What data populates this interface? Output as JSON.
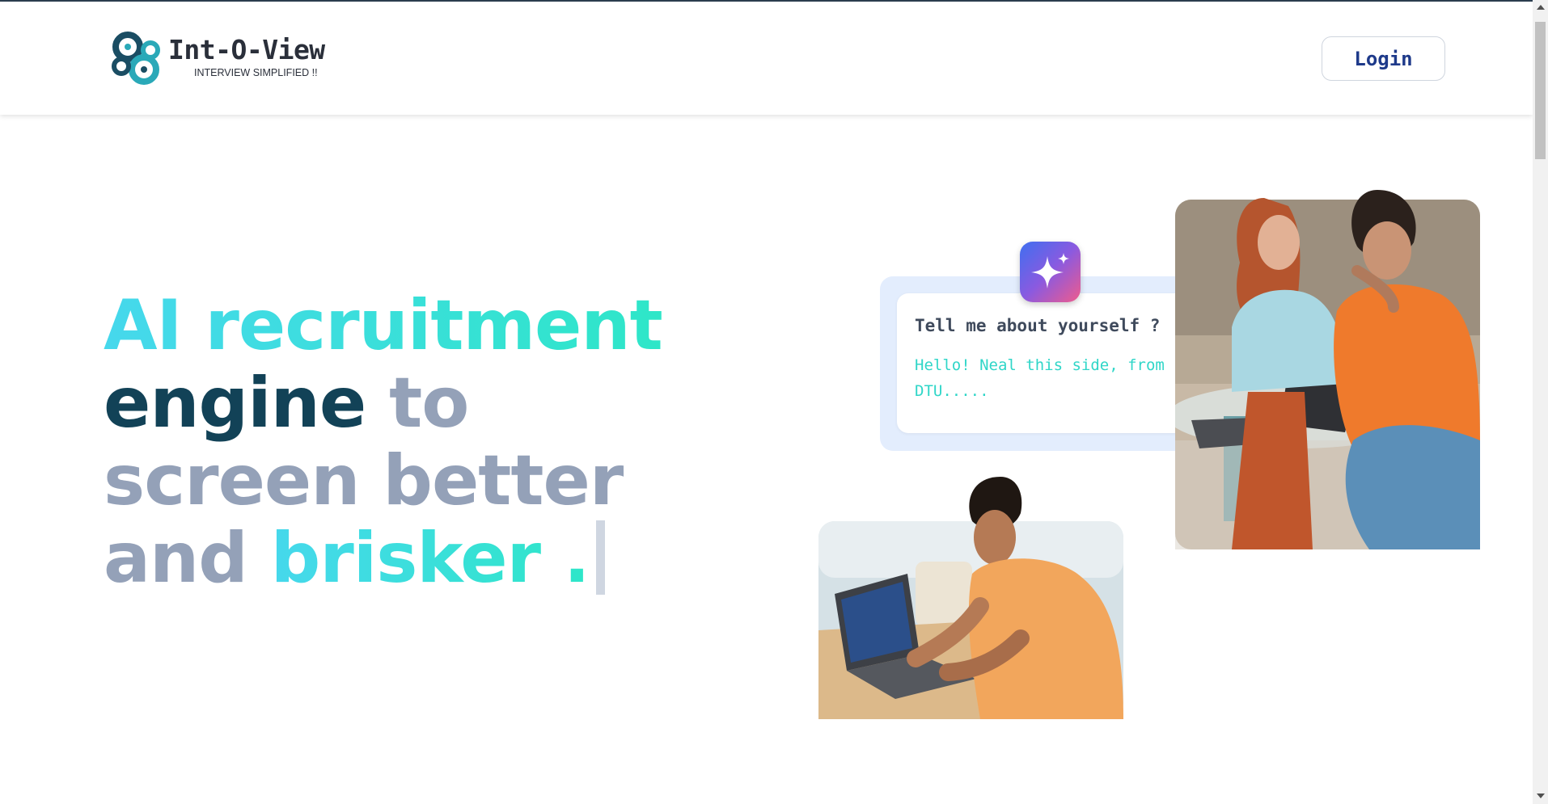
{
  "brand": {
    "name": "Int-O-View",
    "tagline": "INTERVIEW SIMPLIFIED !!"
  },
  "header": {
    "login_label": "Login"
  },
  "hero": {
    "line1": "AI recruitment",
    "line2_dark": "engine",
    "line2_muted": "to",
    "line3": "screen better",
    "line4_muted": "and",
    "line4_grad": "brisker ."
  },
  "chat": {
    "question": "Tell me about yourself ?",
    "answer": "Hello! Neal this side, from DTU....."
  },
  "icons": {
    "ai": "sparkle-icon",
    "logo": "intertwined-loops-logo"
  },
  "colors": {
    "accent_gradient_start": "#46d8ec",
    "accent_gradient_end": "#2ee6c8",
    "dark_text": "#124257",
    "muted_text": "#94a1b8",
    "login_text": "#1e3a8a",
    "chat_answer": "#30d6c8",
    "chat_panel_bg": "#e3edfd"
  }
}
